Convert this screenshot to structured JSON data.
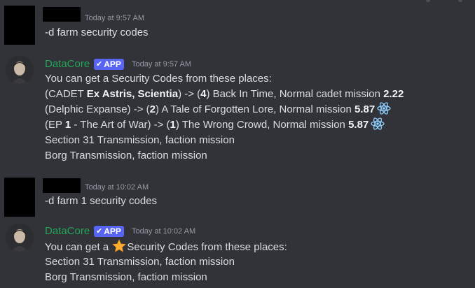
{
  "messages": [
    {
      "timestamp": "Today at 9:57 AM",
      "text": "-d farm security codes"
    },
    {
      "author": "DataCore",
      "tag": "APP",
      "timestamp": "Today at 9:57 AM",
      "intro": "You can get a Security Codes from these places:",
      "lines": [
        {
          "a": "(CADET ",
          "b": "Ex Astris, Scientia",
          "c": ") -> (",
          "d": "4",
          "e": ") Back In Time, Normal cadet mission ",
          "f": "2.22"
        },
        {
          "a": "(Delphic Expanse) -> (",
          "b": "2",
          "c": ") A Tale of Forgotten Lore, Normal mission ",
          "d": "5.87"
        },
        {
          "a": "(EP ",
          "b": "1",
          "c": " - The Art of War) -> (",
          "d": "1",
          "e": ") The Wrong Crowd, Normal mission ",
          "f": "5.87"
        }
      ],
      "extra": [
        "Section 31 Transmission, faction mission",
        "Borg Transmission, faction mission"
      ]
    },
    {
      "timestamp": "Today at 10:02 AM",
      "text": "-d farm 1 security codes"
    },
    {
      "author": "DataCore",
      "tag": "APP",
      "timestamp": "Today at 10:02 AM",
      "intro_pre": "You can get a ",
      "intro_post": "Security Codes from these places:",
      "extra": [
        "Section 31 Transmission, faction mission",
        "Borg Transmission, faction mission"
      ]
    }
  ],
  "icons": {
    "atom": "atom-icon",
    "star": "star-icon",
    "check": "check-icon"
  },
  "colors": {
    "background": "#313338",
    "bot_name": "#23a559",
    "app_tag": "#5865f2",
    "timestamp": "#949ba4",
    "text": "#dbdee1"
  }
}
